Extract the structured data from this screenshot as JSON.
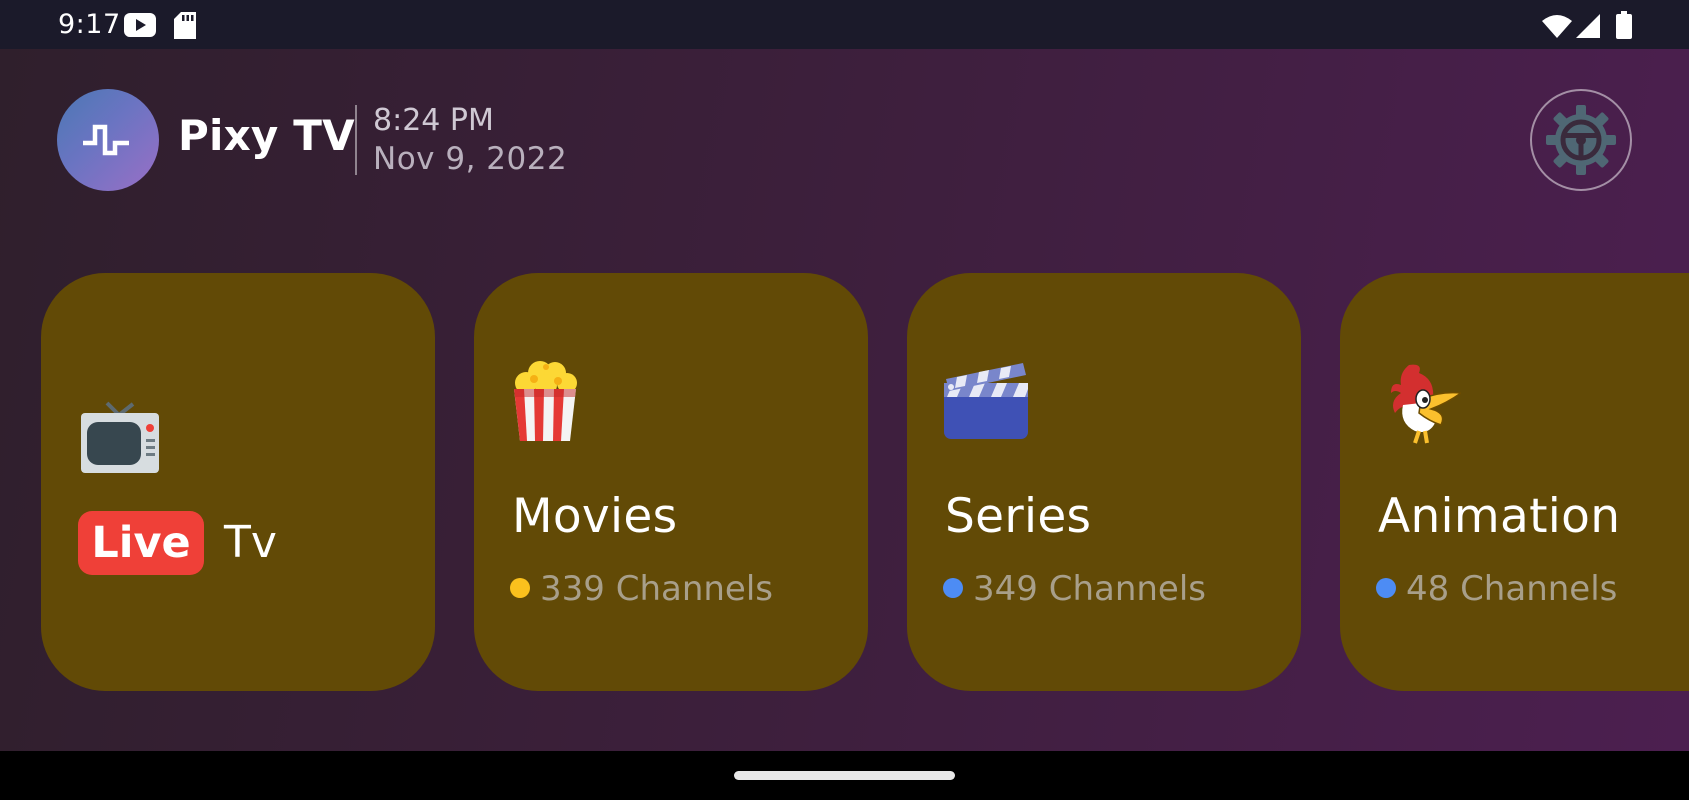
{
  "status_bar": {
    "time": "9:17",
    "icons": [
      "youtube-icon",
      "sd-card-icon",
      "wifi-icon",
      "signal-icon",
      "battery-icon"
    ]
  },
  "header": {
    "logo_icon": "signal-wave-icon",
    "app_title": "Pixy TV",
    "time": "8:24 PM",
    "date": "Nov 9, 2022",
    "settings_icon": "gear-icon"
  },
  "cards": [
    {
      "id": "live-tv",
      "emoji": "📺",
      "badge": "Live",
      "title": "Tv",
      "icon": "television-icon"
    },
    {
      "id": "movies",
      "emoji": "🍿",
      "title": "Movies",
      "count": "339 Channels",
      "dot_color": "#fbc11d",
      "icon": "popcorn-icon"
    },
    {
      "id": "series",
      "emoji": "🎬",
      "title": "Series",
      "count": "349 Channels",
      "dot_color": "#4d8cf4",
      "icon": "clapper-board-icon"
    },
    {
      "id": "animation",
      "emoji": "🐦",
      "title": "Animation",
      "count": "48 Channels",
      "dot_color": "#4d8cf4",
      "icon": "woodpecker-icon"
    }
  ],
  "colors": {
    "card_background": "#624a06",
    "live_badge": "#ef4038",
    "accent_yellow": "#fbc11d",
    "accent_blue": "#4d8cf4"
  }
}
